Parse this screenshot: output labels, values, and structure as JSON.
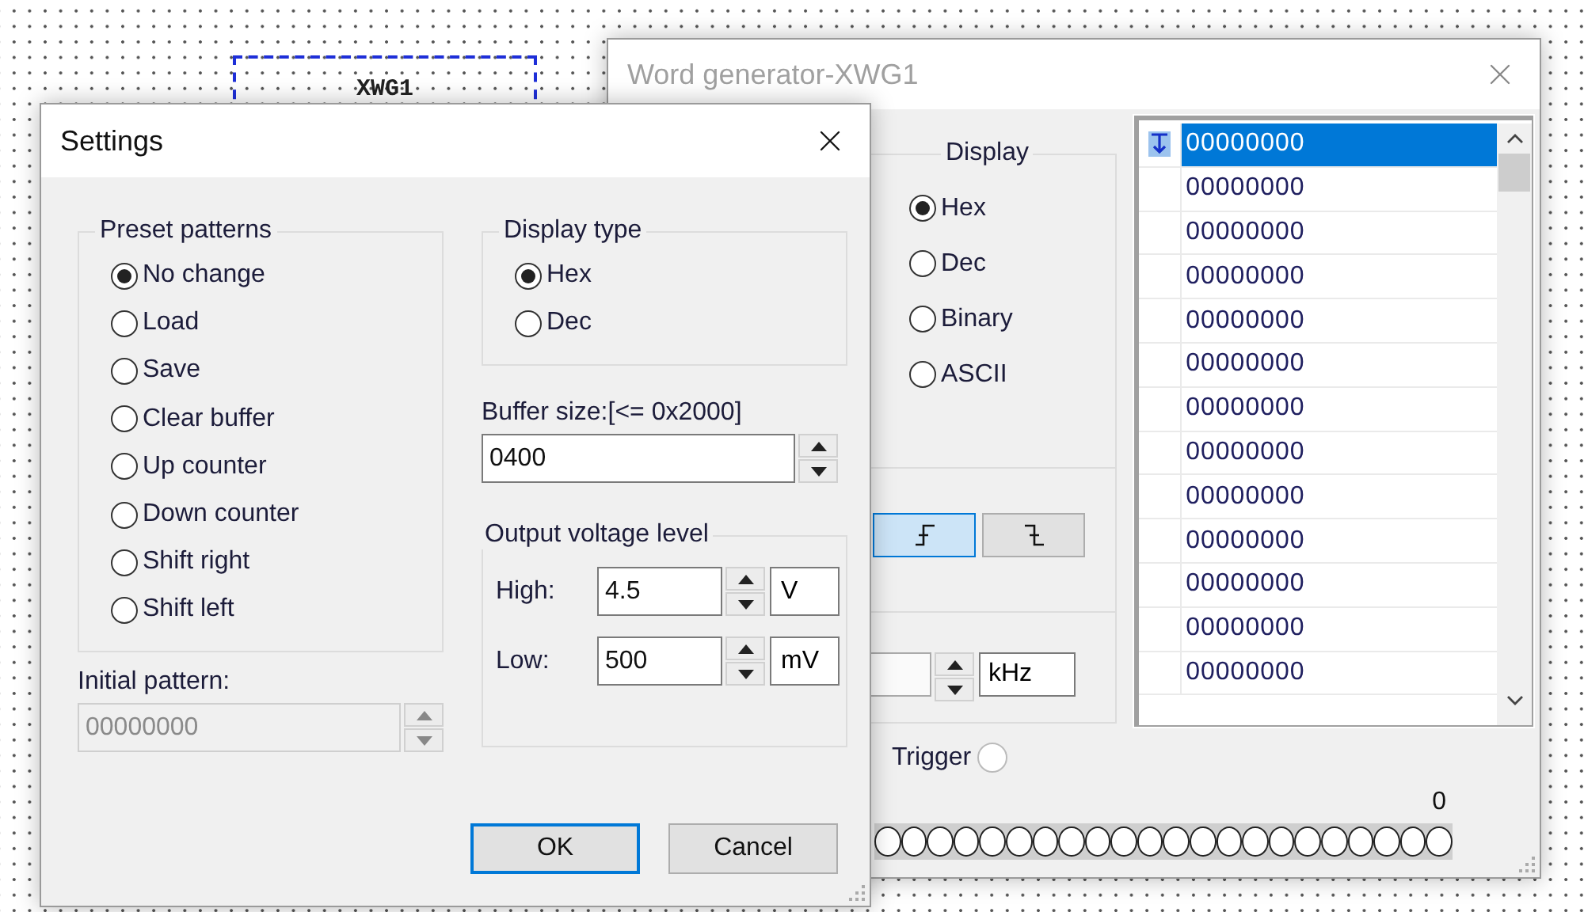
{
  "canvas": {
    "component_label": "XWG1"
  },
  "word_generator": {
    "title": "Word generator-XWG1",
    "display": {
      "label": "Display",
      "options": [
        {
          "label": "Hex",
          "selected": true
        },
        {
          "label": "Dec",
          "selected": false
        },
        {
          "label": "Binary",
          "selected": false
        },
        {
          "label": "ASCII",
          "selected": false
        }
      ]
    },
    "trigger_edges": [
      {
        "kind": "rising",
        "selected": true
      },
      {
        "kind": "falling",
        "selected": false
      }
    ],
    "frequency_unit": "kHz",
    "trigger": {
      "label": "Trigger",
      "on": false
    },
    "bit_label": "0",
    "bits": [
      {
        "on": false
      },
      {
        "on": false
      },
      {
        "on": false
      },
      {
        "on": false
      },
      {
        "on": false
      },
      {
        "on": false
      },
      {
        "on": false
      },
      {
        "on": false
      },
      {
        "on": false
      },
      {
        "on": false
      },
      {
        "on": false
      },
      {
        "on": false
      },
      {
        "on": false
      },
      {
        "on": false
      },
      {
        "on": false
      },
      {
        "on": false
      },
      {
        "on": false
      },
      {
        "on": false
      },
      {
        "on": false
      },
      {
        "on": false
      },
      {
        "on": false
      },
      {
        "on": false
      }
    ],
    "buffer_rows": [
      {
        "value": "00000000",
        "selected": true
      },
      {
        "value": "00000000",
        "selected": false
      },
      {
        "value": "00000000",
        "selected": false
      },
      {
        "value": "00000000",
        "selected": false
      },
      {
        "value": "00000000",
        "selected": false
      },
      {
        "value": "00000000",
        "selected": false
      },
      {
        "value": "00000000",
        "selected": false
      },
      {
        "value": "00000000",
        "selected": false
      },
      {
        "value": "00000000",
        "selected": false
      },
      {
        "value": "00000000",
        "selected": false
      },
      {
        "value": "00000000",
        "selected": false
      },
      {
        "value": "00000000",
        "selected": false
      },
      {
        "value": "00000000",
        "selected": false
      }
    ]
  },
  "settings": {
    "title": "Settings",
    "preset_patterns": {
      "label": "Preset patterns",
      "options": [
        {
          "label": "No change",
          "selected": true
        },
        {
          "label": "Load",
          "selected": false
        },
        {
          "label": "Save",
          "selected": false
        },
        {
          "label": "Clear buffer",
          "selected": false
        },
        {
          "label": "Up counter",
          "selected": false
        },
        {
          "label": "Down counter",
          "selected": false
        },
        {
          "label": "Shift right",
          "selected": false
        },
        {
          "label": "Shift left",
          "selected": false
        }
      ]
    },
    "initial_pattern": {
      "label": "Initial pattern:",
      "value": "00000000",
      "disabled": true
    },
    "display_type": {
      "label": "Display type",
      "options": [
        {
          "label": "Hex",
          "selected": true
        },
        {
          "label": "Dec",
          "selected": false
        }
      ]
    },
    "buffer_size": {
      "label": "Buffer size:[<= 0x2000]",
      "value": "0400"
    },
    "output_voltage": {
      "label": "Output voltage level",
      "rows": [
        {
          "label": "High:",
          "value": "4.5",
          "unit": "V"
        },
        {
          "label": "Low:",
          "value": "500",
          "unit": "mV"
        }
      ]
    },
    "buttons": [
      {
        "label": "OK",
        "focused": true
      },
      {
        "label": "Cancel",
        "focused": false
      }
    ]
  }
}
